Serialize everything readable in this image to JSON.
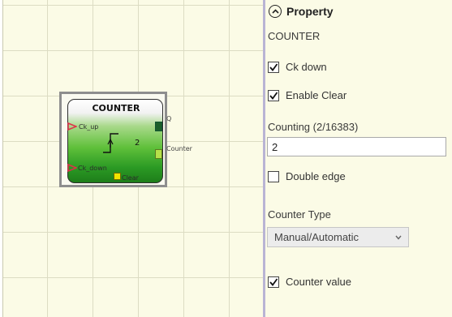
{
  "canvas": {
    "block": {
      "title": "COUNTER",
      "inputs": {
        "ck_up": "Ck_up",
        "ck_down": "Ck_down",
        "clear": "Clear"
      },
      "outputs": {
        "q": "Q",
        "counter": "Counter"
      },
      "value": "2"
    }
  },
  "panel": {
    "header_title": "Property",
    "block_name": "COUNTER",
    "ck_down": {
      "label": "Ck down",
      "checked": true
    },
    "enable_clear": {
      "label": "Enable Clear",
      "checked": true
    },
    "counting": {
      "label": "Counting (2/16383)",
      "value": "2"
    },
    "double_edge": {
      "label": "Double edge",
      "checked": false
    },
    "counter_type": {
      "label": "Counter Type",
      "selected": "Manual/Automatic"
    },
    "counter_value": {
      "label": "Counter value",
      "checked": true
    }
  },
  "colors": {
    "canvas_bg": "#fbfbe6",
    "block_green": "#2b9a24",
    "input_arrow": "#e0304a",
    "divider": "#b9b4d4"
  }
}
